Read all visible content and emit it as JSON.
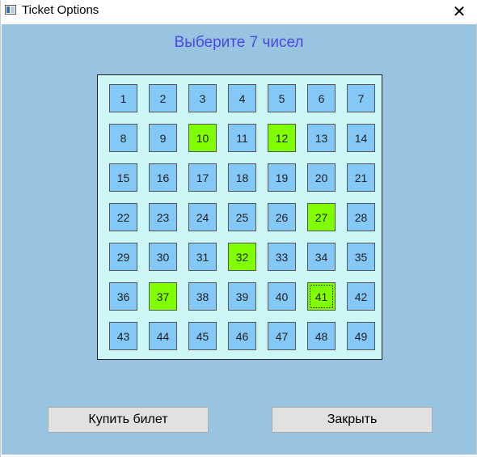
{
  "window": {
    "title": "Ticket Options",
    "close_glyph": "✕"
  },
  "main": {
    "heading": "Выберите 7 чисел",
    "heading_color": "#4a4ae0",
    "background_color": "#98c3e1",
    "grid_background_color": "#cdf6f6",
    "cell_color": "#84c8f7",
    "selected_color": "#80ff00",
    "numbers": [
      1,
      2,
      3,
      4,
      5,
      6,
      7,
      8,
      9,
      10,
      11,
      12,
      13,
      14,
      15,
      16,
      17,
      18,
      19,
      20,
      21,
      22,
      23,
      24,
      25,
      26,
      27,
      28,
      29,
      30,
      31,
      32,
      33,
      34,
      35,
      36,
      37,
      38,
      39,
      40,
      41,
      42,
      43,
      44,
      45,
      46,
      47,
      48,
      49
    ],
    "selected": [
      10,
      12,
      27,
      32,
      37,
      41
    ],
    "focused": 41
  },
  "buttons": {
    "buy_label": "Купить билет",
    "close_label": "Закрыть"
  }
}
